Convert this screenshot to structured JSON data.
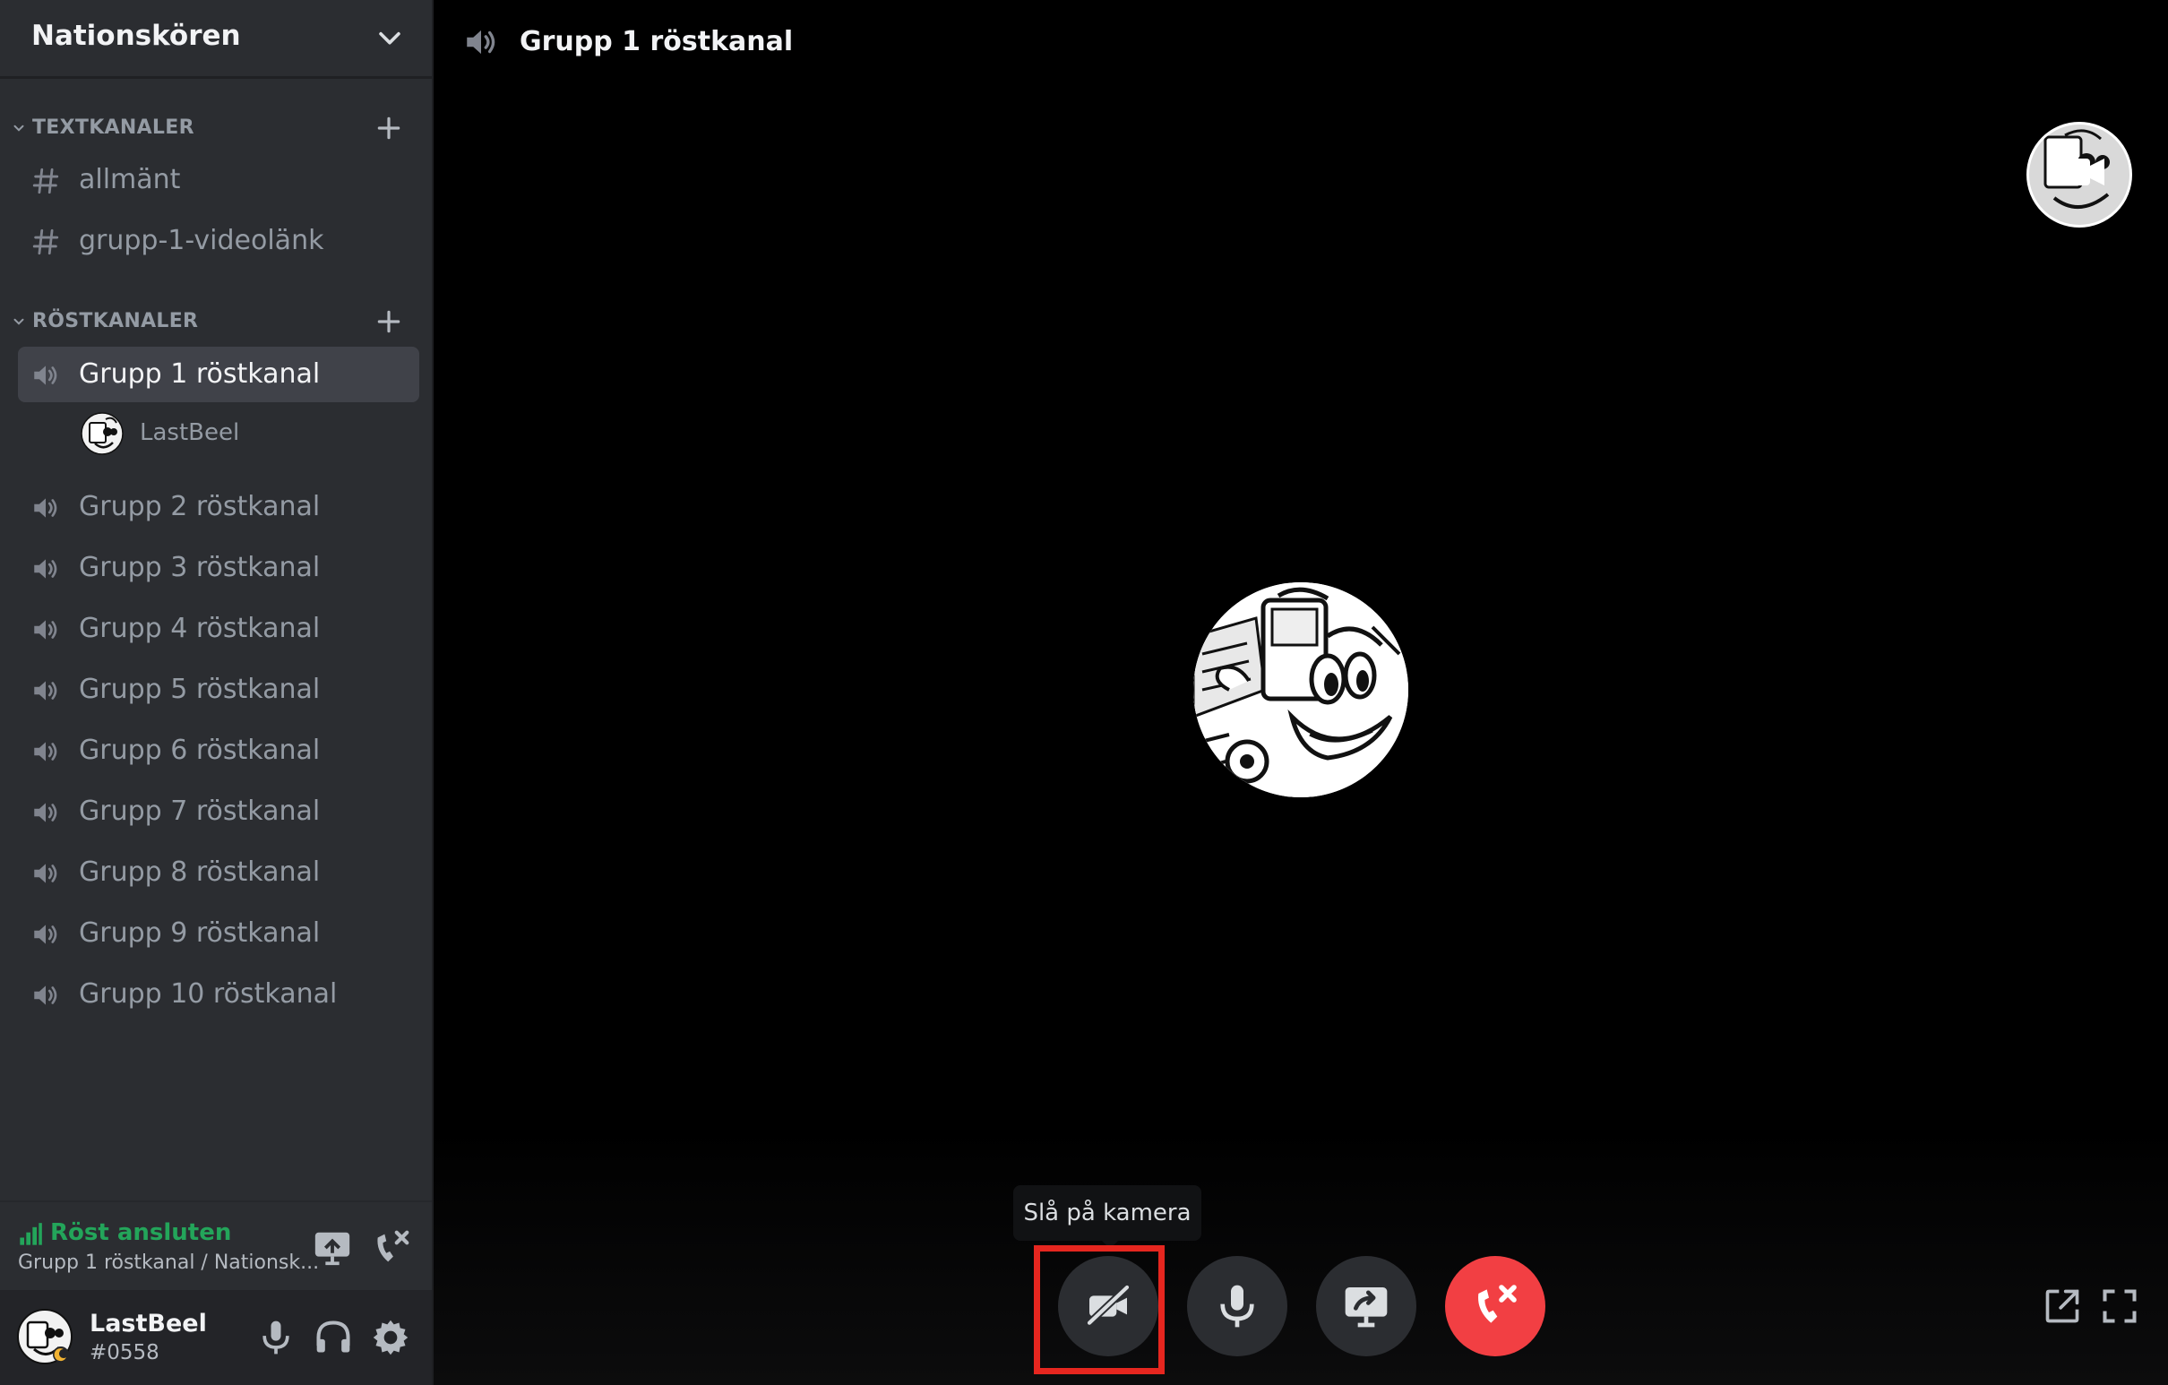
{
  "server": {
    "name": "Nationskören"
  },
  "categories": {
    "text": {
      "label": "TEXTKANALER"
    },
    "voice": {
      "label": "RÖSTKANALER"
    }
  },
  "text_channels": [
    {
      "label": "allmänt"
    },
    {
      "label": "grupp-1-videolänk"
    }
  ],
  "voice_channels": [
    {
      "label": "Grupp 1 röstkanal"
    },
    {
      "label": "Grupp 2 röstkanal"
    },
    {
      "label": "Grupp 3 röstkanal"
    },
    {
      "label": "Grupp 4 röstkanal"
    },
    {
      "label": "Grupp 5 röstkanal"
    },
    {
      "label": "Grupp 6 röstkanal"
    },
    {
      "label": "Grupp 7 röstkanal"
    },
    {
      "label": "Grupp 8 röstkanal"
    },
    {
      "label": "Grupp 9 röstkanal"
    },
    {
      "label": "Grupp 10 röstkanal"
    }
  ],
  "voice_member": {
    "name": "LastBeel"
  },
  "voice_status": {
    "status": "Röst ansluten",
    "channel": "Grupp 1 röstkanal / Nationsk..."
  },
  "user": {
    "name": "LastBeel",
    "tag": "#0558"
  },
  "main": {
    "title": "Grupp 1 röstkanal"
  },
  "tooltip": {
    "text": "Slå på kamera"
  },
  "colors": {
    "accent_green": "#23a55a",
    "leave_red": "#f23f43",
    "highlight_red": "#e6261f"
  }
}
